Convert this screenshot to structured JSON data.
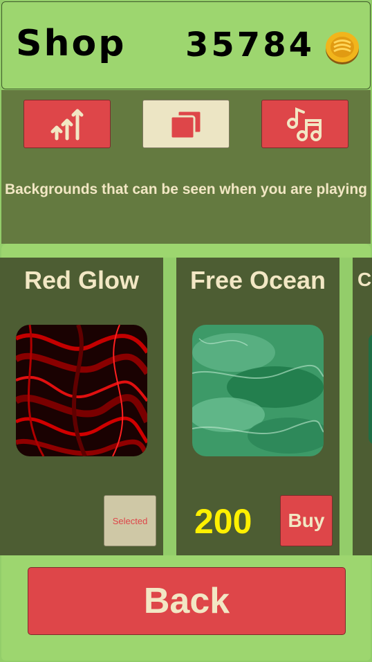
{
  "header": {
    "title": "Shop",
    "coins": "35784",
    "coin_icon": "gold-coin-icon"
  },
  "tabs": [
    {
      "name": "upgrades",
      "icon": "arrows-up-icon",
      "active": false
    },
    {
      "name": "backgrounds",
      "icon": "layers-icon",
      "active": true
    },
    {
      "name": "music",
      "icon": "music-notes-icon",
      "active": false
    }
  ],
  "description": "Backgrounds that can be seen when you are playing",
  "cards": [
    {
      "name": "Red Glow",
      "status": "Selected"
    },
    {
      "name": "Free Ocean",
      "price": "200",
      "buy_label": "Buy"
    },
    {
      "name": "C"
    }
  ],
  "back_label": "Back",
  "colors": {
    "panel_green": "#9dd66f",
    "dark_green": "#4d5d33",
    "mid_green": "#647a40",
    "button_red": "#de4649",
    "cream": "#f2e7c4",
    "price_yellow": "#fff000"
  }
}
